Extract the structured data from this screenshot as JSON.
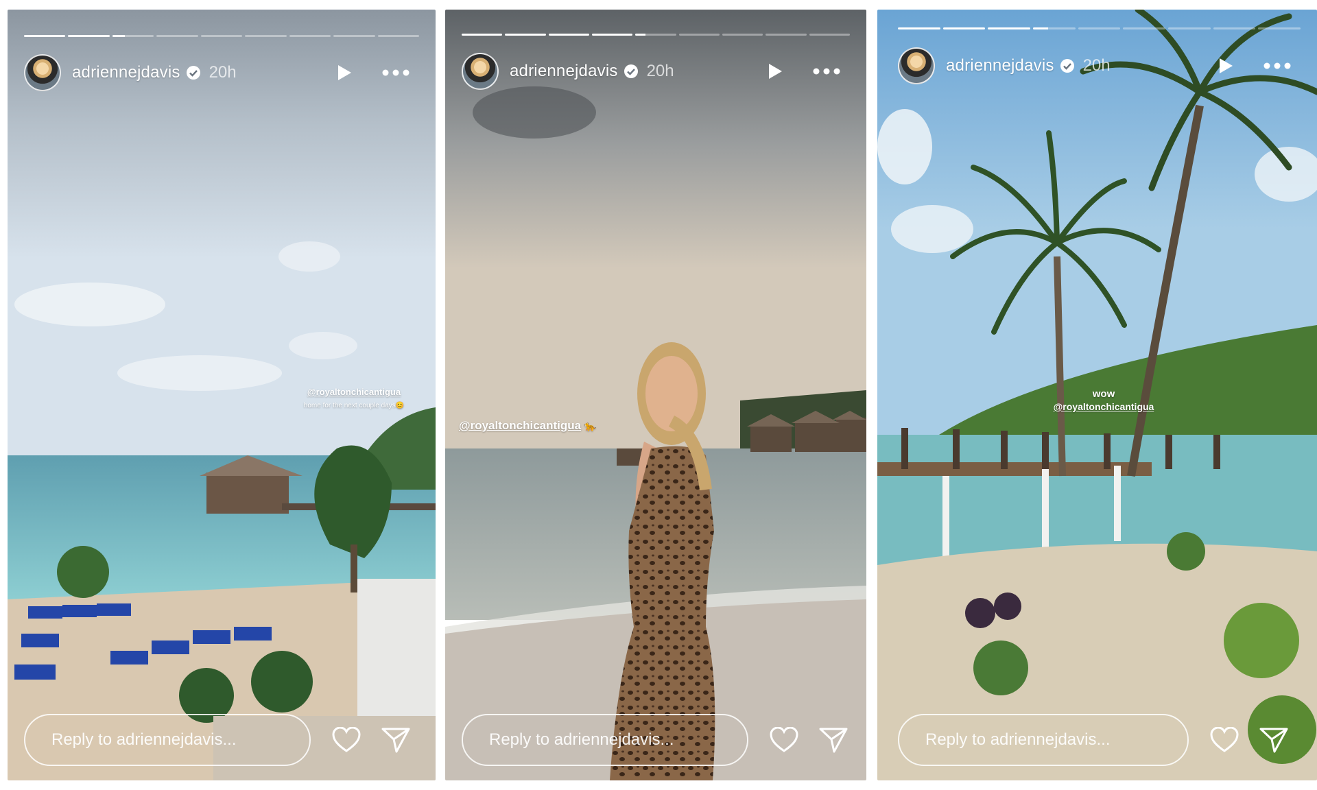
{
  "colors": {
    "accent_white": "#ffffff",
    "muted_text": "rgba(255,255,255,0.72)"
  },
  "icons": {
    "verified": "verified-badge-icon",
    "play": "play-icon",
    "more": "more-dots-icon",
    "like": "heart-icon",
    "share": "send-icon"
  },
  "stories": [
    {
      "username": "adriennejdavis",
      "time": "20h",
      "progress_fractions": [
        1,
        1,
        0.3,
        0,
        0,
        0,
        0,
        0,
        0
      ],
      "sticker": {
        "mention": "@royaltonchicantigua",
        "caption": "home for the next couple days😊"
      },
      "reply_placeholder": "Reply to adriennejdavis..."
    },
    {
      "username": "adriennejdavis",
      "time": "20h",
      "progress_fractions": [
        1,
        1,
        1,
        1,
        0.25,
        0,
        0,
        0,
        0
      ],
      "sticker": {
        "mention": "@royaltonchicantigua",
        "emoji": "🐆"
      },
      "reply_placeholder": "Reply to adriennejdavis..."
    },
    {
      "username": "adriennejdavis",
      "time": "20h",
      "progress_fractions": [
        1,
        1,
        1,
        0.35,
        0,
        0,
        0,
        0,
        0
      ],
      "sticker": {
        "title": "wow",
        "mention": "@royaltonchicantigua"
      },
      "reply_placeholder": "Reply to adriennejdavis..."
    }
  ]
}
